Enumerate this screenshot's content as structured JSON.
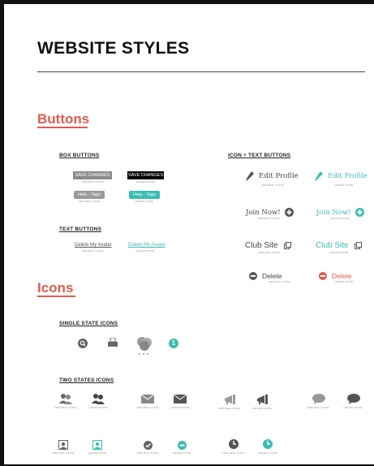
{
  "title": "WEBSITE STYLES",
  "colors": {
    "accent": "#e35b4f",
    "teal": "#3bbdb2",
    "gray": "#8c8c8c",
    "dark": "#555"
  },
  "states": {
    "original": "ORIGINAL STATE",
    "hover": "HOVER STATE"
  },
  "buttons": {
    "heading": "Buttons",
    "box": {
      "heading": "BOX BUTTONS",
      "save": "SAVE CHANGES",
      "help": "Help - Tags"
    },
    "text": {
      "heading": "TEXT BUTTONS",
      "link": "Delete My Avatar"
    },
    "icontext": {
      "heading": "ICON + TEXT BUTTONS",
      "edit": "Edit Profile",
      "join": "Join Now!",
      "club": "Club Site",
      "del": "Delete"
    }
  },
  "icons": {
    "heading": "Icons",
    "single": {
      "heading": "SINGLE STATE ICONS",
      "badge": "1",
      "icons": [
        "search-icon",
        "printer-icon",
        "loading-cloud-icon",
        "count-badge-icon"
      ]
    },
    "two": {
      "heading": "TWO STATES ICONS",
      "icons": [
        "users-icon",
        "envelope-icon",
        "megaphone-icon",
        "speech-bubble-icon",
        "portrait-icon",
        "check-circle-icon",
        "minus-circle-icon",
        "clock-icon"
      ]
    }
  }
}
